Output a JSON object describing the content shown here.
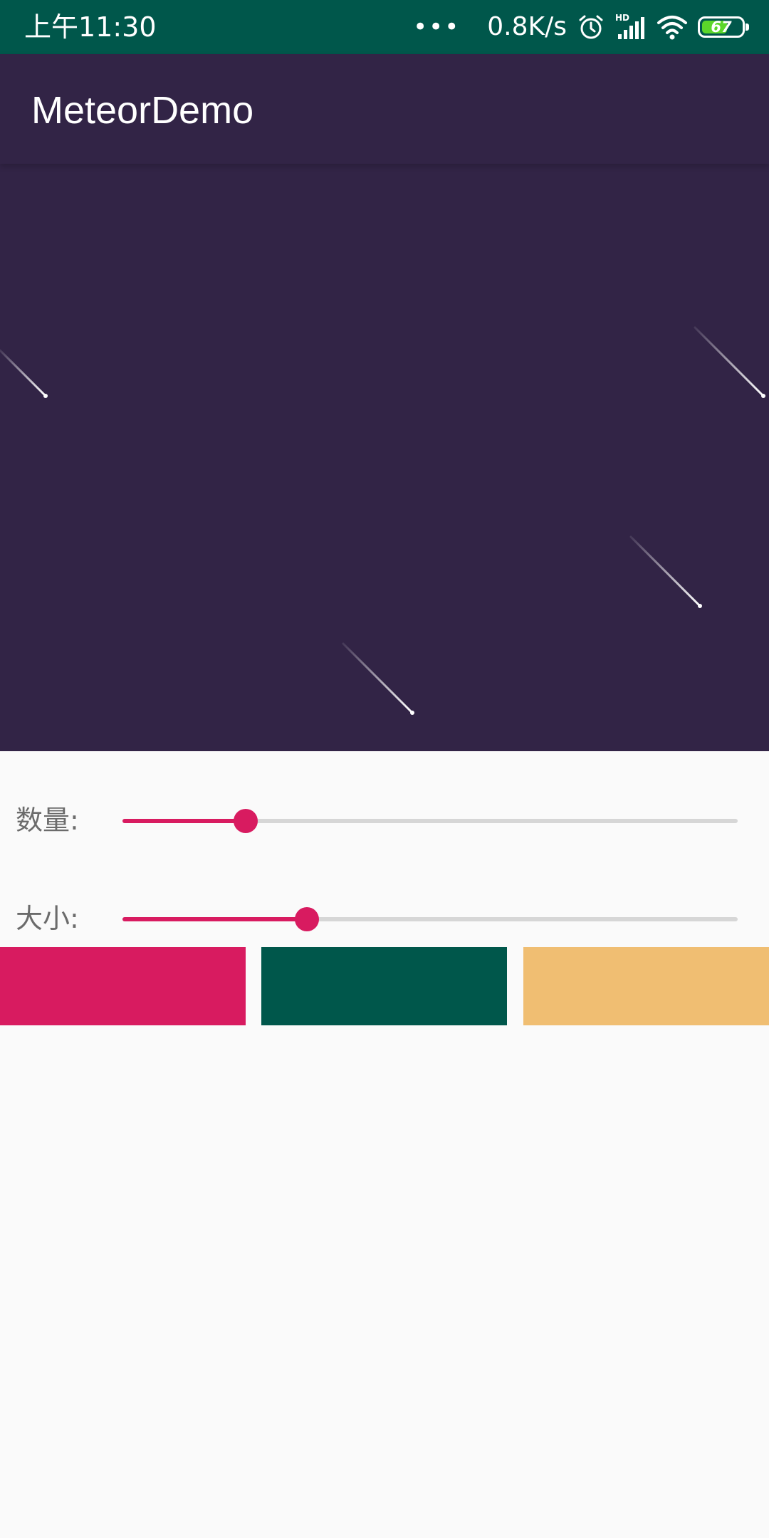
{
  "status_bar": {
    "time": "上午11:30",
    "dots": "•••",
    "speed": "0.8K/s",
    "battery": "67",
    "background": "#00574b"
  },
  "app": {
    "title": "MeteorDemo",
    "bar_color": "#322446"
  },
  "meteor_view": {
    "background": "#322446",
    "meteor_color": "#ffffff"
  },
  "controls": {
    "count": {
      "label": "数量:",
      "value": 0.2
    },
    "size": {
      "label": "大小:",
      "value": 0.3
    }
  },
  "color_buttons": [
    {
      "name": "pink",
      "color": "#d81b60"
    },
    {
      "name": "green",
      "color": "#00574b"
    },
    {
      "name": "amber",
      "color": "#f0be72"
    }
  ],
  "accent": "#d81b60"
}
